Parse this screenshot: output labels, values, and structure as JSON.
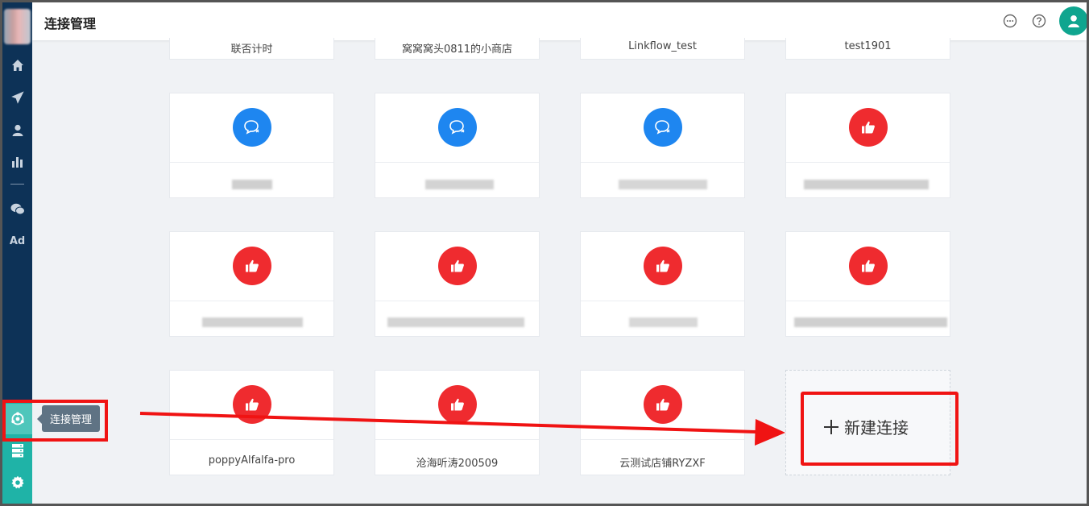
{
  "header": {
    "title": "连接管理"
  },
  "top_actions": [
    {
      "icon": "chat-icon"
    },
    {
      "icon": "help-icon"
    },
    {
      "icon": "user-avatar-icon"
    }
  ],
  "sidebar": {
    "items": [
      {
        "icon": "home-icon"
      },
      {
        "icon": "send-icon"
      },
      {
        "icon": "user-icon"
      },
      {
        "icon": "bar-chart-icon"
      },
      {
        "icon": "wechat-icon"
      },
      {
        "label": "Ad"
      },
      {
        "icon": "connection-icon",
        "active": true
      },
      {
        "icon": "server-icon"
      },
      {
        "icon": "gear-icon"
      }
    ],
    "tooltip": "连接管理"
  },
  "partial_row": [
    "联否计时",
    "窝窝窝头0811的小商店",
    "Linkflow_test",
    "test1901"
  ],
  "cards": [
    {
      "icon": "chat-bubble-icon",
      "color": "#1e86f0",
      "name": ""
    },
    {
      "icon": "chat-bubble-icon",
      "color": "#1e86f0",
      "name": ""
    },
    {
      "icon": "chat-bubble-icon",
      "color": "#1e86f0",
      "name": ""
    },
    {
      "icon": "thumbs-up-icon",
      "color": "#ef2b2f",
      "name": ""
    },
    {
      "icon": "thumbs-up-icon",
      "color": "#ef2b2f",
      "name": ""
    },
    {
      "icon": "thumbs-up-icon",
      "color": "#ef2b2f",
      "name": ""
    },
    {
      "icon": "thumbs-up-icon",
      "color": "#ef2b2f",
      "name": ""
    },
    {
      "icon": "thumbs-up-icon",
      "color": "#ef2b2f",
      "name": ""
    },
    {
      "icon": "thumbs-up-icon",
      "color": "#ef2b2f",
      "name": "poppyAlfalfa-pro"
    },
    {
      "icon": "thumbs-up-icon",
      "color": "#ef2b2f",
      "name": "沧海听涛200509"
    },
    {
      "icon": "thumbs-up-icon",
      "color": "#ef2b2f",
      "name": "云测试店铺RYZXF"
    }
  ],
  "new_connection": {
    "label": "新建连接"
  },
  "colors": {
    "sidebar": "#0d3257",
    "accent": "#1fb3a7",
    "annotation": "#f01313"
  }
}
